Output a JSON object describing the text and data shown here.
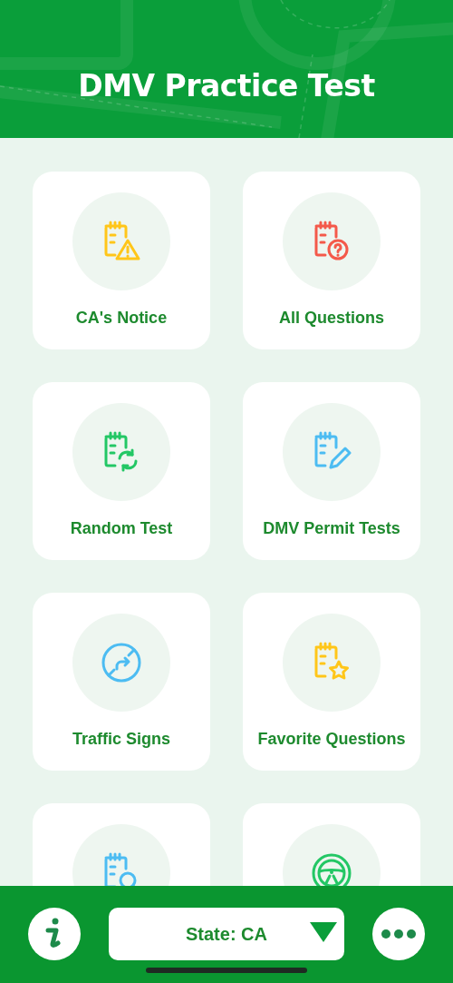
{
  "header": {
    "title": "DMV Practice Test"
  },
  "cards": [
    {
      "kind": "notice",
      "color": "#ffc619",
      "label": "CA's Notice"
    },
    {
      "kind": "question",
      "color": "#f4594a",
      "label": "All Questions"
    },
    {
      "kind": "random",
      "color": "#23c765",
      "label": "Random Test"
    },
    {
      "kind": "edit",
      "color": "#4cbcf2",
      "label": "DMV Permit Tests"
    },
    {
      "kind": "sign",
      "color": "#4cbcf2",
      "label": "Traffic Signs"
    },
    {
      "kind": "star",
      "color": "#ffc619",
      "label": "Favorite Questions"
    },
    {
      "kind": "search",
      "color": "#4cbcf2"
    },
    {
      "kind": "wheel",
      "color": "#23c765"
    }
  ],
  "footer": {
    "state_select": "State: CA"
  }
}
